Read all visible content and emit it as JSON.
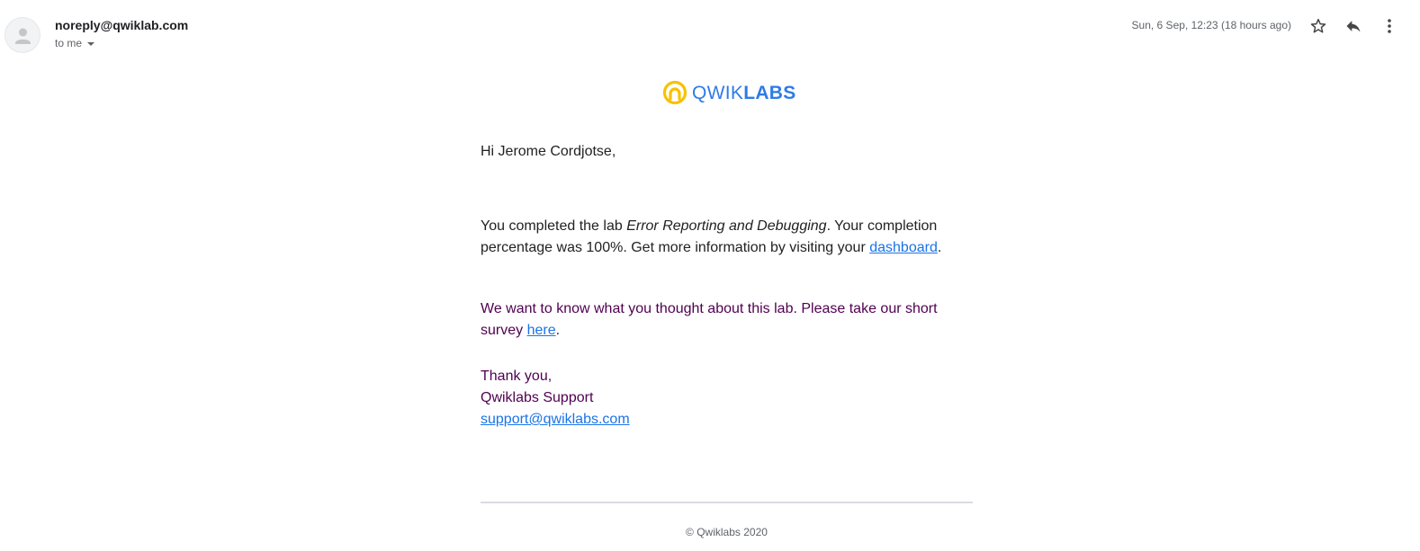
{
  "email_header": {
    "sender": "noreply@qwiklab.com",
    "recipient_label": "to me",
    "timestamp": "Sun, 6 Sep, 12:23 (18 hours ago)"
  },
  "logo": {
    "text_light": "QWIK",
    "text_bold": "LABS",
    "brand_color": "#2e7be6",
    "icon_color": "#f7c200"
  },
  "body": {
    "greeting": "Hi Jerome Cordjotse,",
    "paragraph1": {
      "before_lab": "You completed the lab ",
      "lab_name": "Error Reporting and Debugging",
      "after_lab": ". Your completion percentage was 100%. Get more information by visiting your ",
      "link_text": "dashboard",
      "end": "."
    },
    "paragraph2": {
      "text": "We want to know what you thought about this lab. Please take our short survey ",
      "link_text": "here",
      "end": "."
    },
    "signoff": {
      "thanks": "Thank you,",
      "team": "Qwiklabs Support",
      "email": "support@qwiklabs.com"
    }
  },
  "footer": {
    "copyright": "© Qwiklabs 2020"
  },
  "colors": {
    "link": "#1a73e8",
    "quoted_text": "#500050",
    "body_text": "#222222"
  }
}
